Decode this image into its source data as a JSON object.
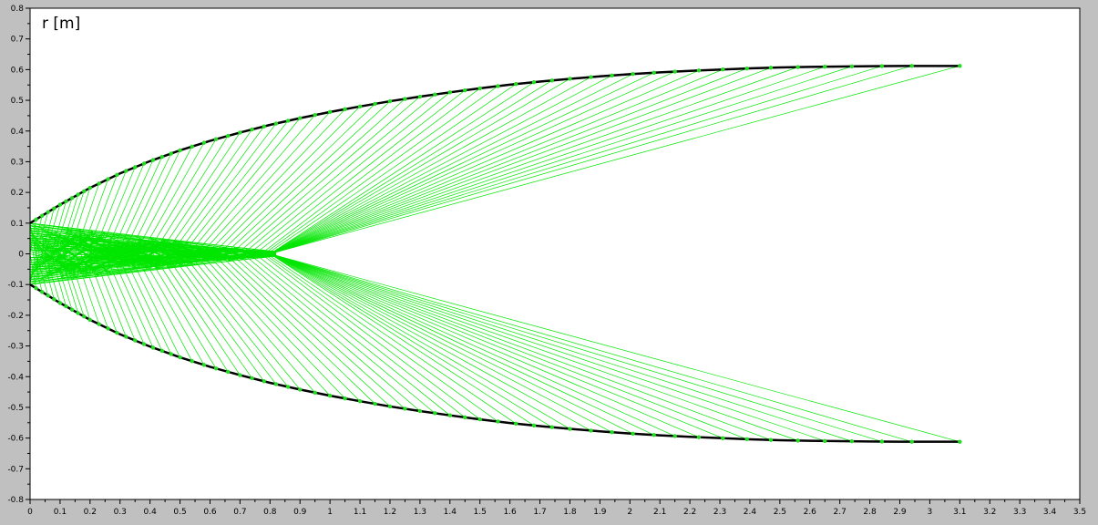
{
  "chart_data": {
    "type": "line",
    "title": "",
    "xlabel": "",
    "ylabel": "r [m]",
    "xlim": [
      0,
      3.5
    ],
    "ylim": [
      -0.8,
      0.8
    ],
    "grid": false,
    "x_ticks": [
      "0",
      "0.1",
      "0.2",
      "0.3",
      "0.4",
      "0.5",
      "0.6",
      "0.7",
      "0.8",
      "0.9",
      "1",
      "1.1",
      "1.2",
      "1.3",
      "1.4",
      "1.5",
      "1.6",
      "1.7",
      "1.8",
      "1.9",
      "2",
      "2.1",
      "2.2",
      "2.3",
      "2.4",
      "2.5",
      "2.6",
      "2.7",
      "2.8",
      "2.9",
      "3",
      "3.1",
      "3.2",
      "3.3",
      "3.4",
      "3.5"
    ],
    "y_ticks": [
      "0.8",
      "0.7",
      "0.6",
      "0.5",
      "0.4",
      "0.3",
      "0.2",
      "0.1",
      "0",
      "-0.1",
      "-0.2",
      "-0.3",
      "-0.4",
      "-0.5",
      "-0.6",
      "-0.7",
      "-0.8"
    ],
    "colors": {
      "contour": "#000000",
      "characteristics": "#00e600",
      "points": "#22dd22",
      "background": "#c0c0c0",
      "plot_area": "#ffffff"
    },
    "series": [
      {
        "type": "line",
        "symmetric": true,
        "x": [
          0,
          0.05,
          0.1,
          0.2,
          0.3,
          0.4,
          0.5,
          0.6,
          0.7,
          0.8,
          0.9,
          1.0,
          1.1,
          1.2,
          1.3,
          1.4,
          1.5,
          1.6,
          1.7,
          1.8,
          1.9,
          2.0,
          2.1,
          2.2,
          2.3,
          2.4,
          2.5,
          2.6,
          2.7,
          2.8,
          2.9,
          3.0,
          3.1
        ],
        "y": [
          0.1,
          0.13,
          0.16,
          0.215,
          0.262,
          0.302,
          0.337,
          0.368,
          0.395,
          0.42,
          0.442,
          0.462,
          0.48,
          0.497,
          0.512,
          0.526,
          0.539,
          0.551,
          0.561,
          0.57,
          0.578,
          0.585,
          0.591,
          0.596,
          0.6,
          0.604,
          0.607,
          0.609,
          0.61,
          0.611,
          0.612,
          0.612,
          0.612
        ]
      },
      {
        "type": "characteristics",
        "wall_x": [
          0.02,
          0.04,
          0.06,
          0.08,
          0.1,
          0.12,
          0.14,
          0.16,
          0.18,
          0.2,
          0.23,
          0.26,
          0.29,
          0.32,
          0.35,
          0.38,
          0.41,
          0.44,
          0.47,
          0.5,
          0.54,
          0.58,
          0.62,
          0.66,
          0.7,
          0.74,
          0.78,
          0.82,
          0.86,
          0.9,
          0.95,
          1.0,
          1.05,
          1.1,
          1.15,
          1.2,
          1.25,
          1.3,
          1.35,
          1.4,
          1.45,
          1.5,
          1.56,
          1.62,
          1.68,
          1.74,
          1.8,
          1.87,
          1.94,
          2.01,
          2.08,
          2.15,
          2.23,
          2.31,
          2.39,
          2.47,
          2.56,
          2.65,
          2.74,
          2.84,
          2.94,
          3.1
        ],
        "axis_x": [
          0.0,
          0.01,
          0.02,
          0.04,
          0.05,
          0.07,
          0.08,
          0.1,
          0.11,
          0.13,
          0.15,
          0.17,
          0.19,
          0.21,
          0.23,
          0.25,
          0.27,
          0.29,
          0.31,
          0.33,
          0.35,
          0.37,
          0.39,
          0.41,
          0.43,
          0.45,
          0.47,
          0.49,
          0.51,
          0.53,
          0.55,
          0.57,
          0.59,
          0.61,
          0.63,
          0.65,
          0.67,
          0.69,
          0.71,
          0.73,
          0.75,
          0.77,
          0.78,
          0.79,
          0.8,
          0.8,
          0.8,
          0.8,
          0.8,
          0.8,
          0.8,
          0.8,
          0.8,
          0.8,
          0.8,
          0.8,
          0.8,
          0.8,
          0.8,
          0.8,
          0.8,
          0.8
        ]
      }
    ]
  }
}
